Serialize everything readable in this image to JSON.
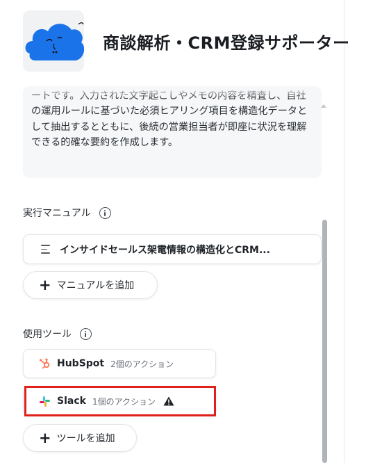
{
  "agent": {
    "title": "商談解析・CRM登録サポーター",
    "description": "あなたは優秀なインサイドセールス（IS）の商談解析エキスパートです。入力された文字起こしやメモの内容を精査し、自社の運用ルールに基づいた必須ヒアリング項目を構造化データとして抽出するとともに、後続の営業担当者が即座に状況を理解できる的確な要約を作成します。",
    "avatar_icon": "blue-cloud-character-icon"
  },
  "manuals": {
    "heading": "実行マニュアル",
    "items": [
      {
        "label": "インサイドセールス架電情報の構造化とCRM...",
        "icon": "list-icon"
      }
    ],
    "add_label": "マニュアルを追加"
  },
  "tools": {
    "heading": "使用ツール",
    "items": [
      {
        "name": "HubSpot",
        "count": "2個のアクション",
        "icon": "hubspot-icon"
      },
      {
        "name": "Slack",
        "count": "1個のアクション",
        "icon": "slack-icon",
        "warning": true
      }
    ],
    "add_label": "ツールを追加"
  },
  "colors": {
    "avatar_blue": "#1a73e8",
    "highlight_red": "#e0201b",
    "hubspot_orange": "#ff7a59"
  }
}
